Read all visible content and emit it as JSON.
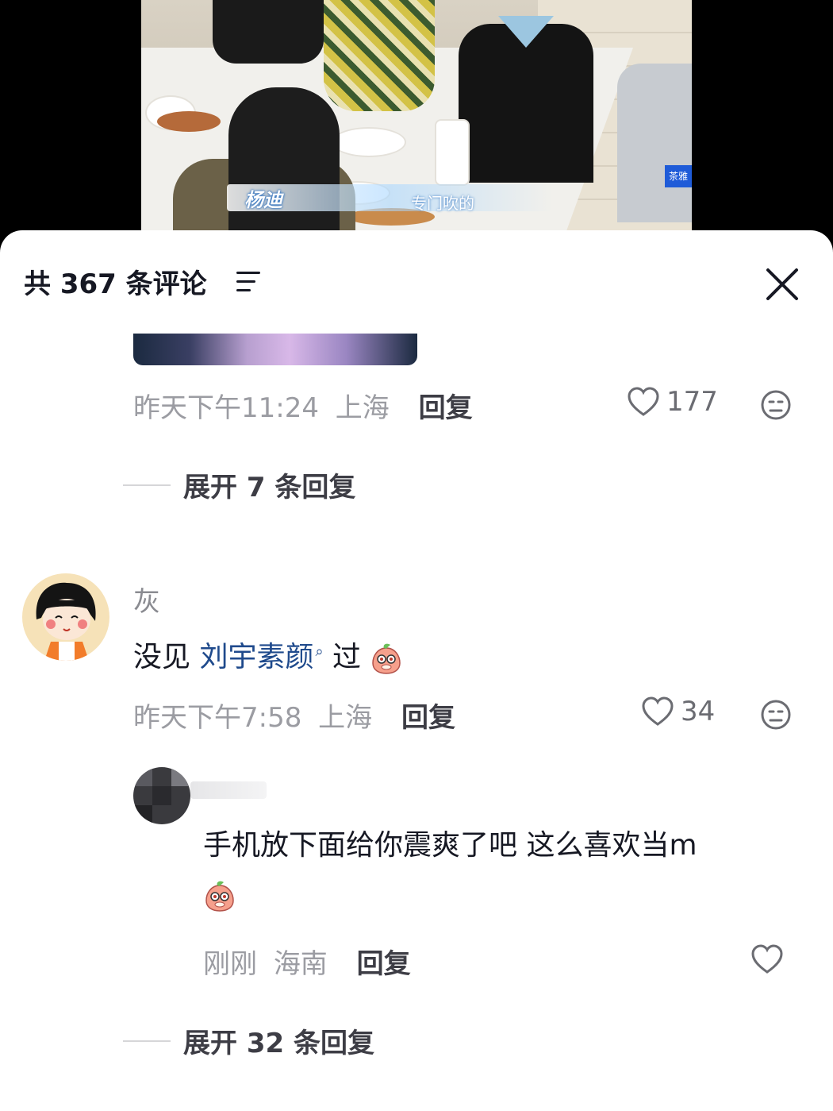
{
  "video": {
    "caption_name": "杨迪",
    "caption_text": "专门吹的",
    "logo_text": "茶雅"
  },
  "comments_panel": {
    "count_label": "共 367 条评论",
    "filter_icon": "filter-icon",
    "close_icon": "close-icon"
  },
  "comment_prev": {
    "time": "昨天下午11:24",
    "location": "上海",
    "reply_label": "回复",
    "likes": "177",
    "expand_label": "展开 7 条回复"
  },
  "comment_main": {
    "username": "灰",
    "text_before": "没见 ",
    "mention": "刘宇素颜",
    "text_after": " 过",
    "time": "昨天下午7:58",
    "location": "上海",
    "reply_label": "回复",
    "likes": "34"
  },
  "reply": {
    "text_line1": "手机放下面给你震爽了吧 这么喜欢当m",
    "time": "刚刚",
    "location": "海南",
    "reply_label": "回复",
    "expand_label": "展开 32 条回复"
  },
  "colors": {
    "mention": "#1f4a8c",
    "meta": "#9b9ca2"
  }
}
